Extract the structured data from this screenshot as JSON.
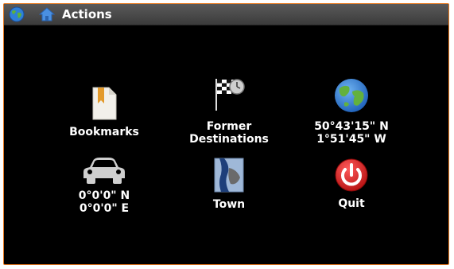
{
  "window": {
    "title": "Actions",
    "globe_icon": "globe-icon",
    "home_icon": "home-icon"
  },
  "actions": {
    "bookmarks": {
      "label": "Bookmarks",
      "icon": "bookmark-icon"
    },
    "former_destinations": {
      "line1": "Former",
      "line2": "Destinations",
      "icon": "checkered-flag-clock-icon"
    },
    "current_position": {
      "line1": "50°43'15\" N",
      "line2": "1°51'45\" W",
      "icon": "globe-icon"
    },
    "car_position": {
      "line1": "0°0'0\" N",
      "line2": "0°0'0\" E",
      "icon": "car-icon"
    },
    "town": {
      "label": "Town",
      "icon": "town-map-icon"
    },
    "quit": {
      "label": "Quit",
      "icon": "power-icon"
    }
  },
  "colors": {
    "frame": "#e8791e",
    "background": "#000000",
    "titlebar": "#4a4a4a",
    "quit_red": "#d62020"
  }
}
